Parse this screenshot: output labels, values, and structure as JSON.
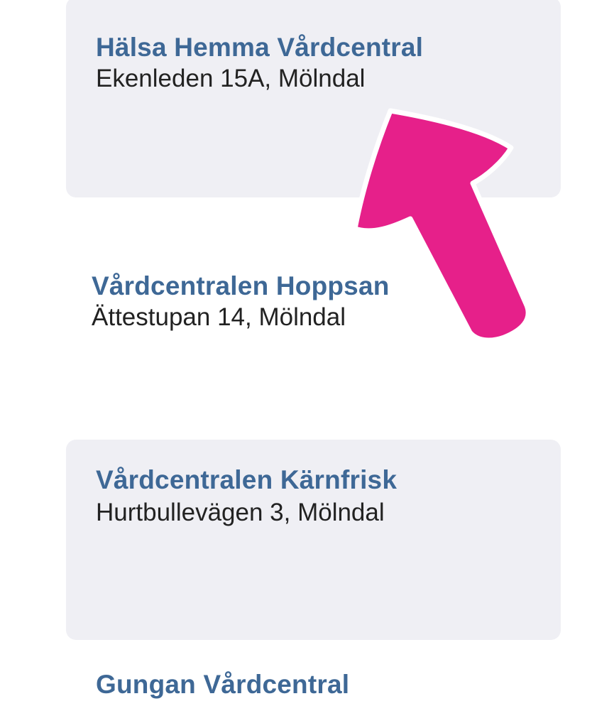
{
  "clinics": [
    {
      "name": "Hälsa Hemma Vårdcentral",
      "address": "Ekenleden 15A, Mölndal"
    },
    {
      "name": "Vårdcentralen Hoppsan",
      "address": "Ättestupan 14, Mölndal"
    },
    {
      "name": "Vårdcentralen Kärnfrisk",
      "address": "Hurtbullevägen 3, Mölndal"
    },
    {
      "name": "Gungan Vårdcentral",
      "address": ""
    }
  ],
  "colors": {
    "card_background": "#efeff4",
    "clinic_name": "#3e6896",
    "clinic_address": "#222222",
    "arrow_fill": "#e6208a",
    "arrow_outline": "#ffffff"
  },
  "icons": {
    "annotation": "arrow-pointer-icon"
  }
}
